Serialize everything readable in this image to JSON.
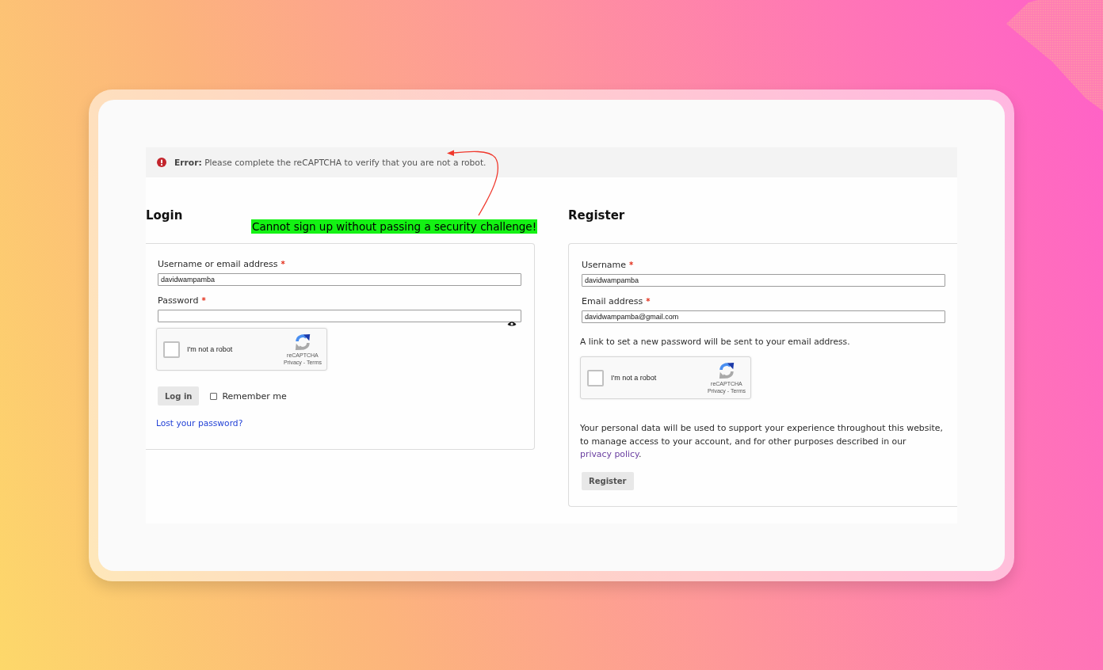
{
  "error_notice": {
    "message": "**Error:** Please complete the reCAPTCHA to verify that you are not a robot."
  },
  "annotation": {
    "text": "Cannot sign up without passing a security challenge!"
  },
  "login": {
    "title": "Login",
    "fields": [
      {
        "kind": "text",
        "label": "Username or email address",
        "required_mark": "*",
        "value": "davidwampamba"
      },
      {
        "kind": "password",
        "label": "Password",
        "required_mark": "*"
      }
    ],
    "captcha": {
      "label": "I'm not a robot",
      "checked": false,
      "brand": "reCAPTCHA",
      "links": "Privacy - Terms"
    },
    "submit_button": "Log in",
    "remember": {
      "label": "Remember me",
      "checked": false
    },
    "lost_password_link": "Lost your password?"
  },
  "register": {
    "title": "Register",
    "fields": [
      {
        "label": "Username",
        "required_mark": "*",
        "value": "davidwampamba"
      },
      {
        "label": "Email address",
        "required_mark": "*",
        "value": "davidwampamba@gmail.com"
      }
    ],
    "note": "A link to set a new password will be sent to your email address.",
    "captcha": {
      "label": "I'm not a robot",
      "checked": false,
      "brand": "reCAPTCHA",
      "links": "Privacy - Terms"
    },
    "privacy_notice": {
      "text": "Your personal data will be used to support your experience throughout this website, to manage access to your account, and for other purposes described in our ",
      "link": "privacy policy",
      "end": "."
    },
    "submit_button": "Register"
  }
}
